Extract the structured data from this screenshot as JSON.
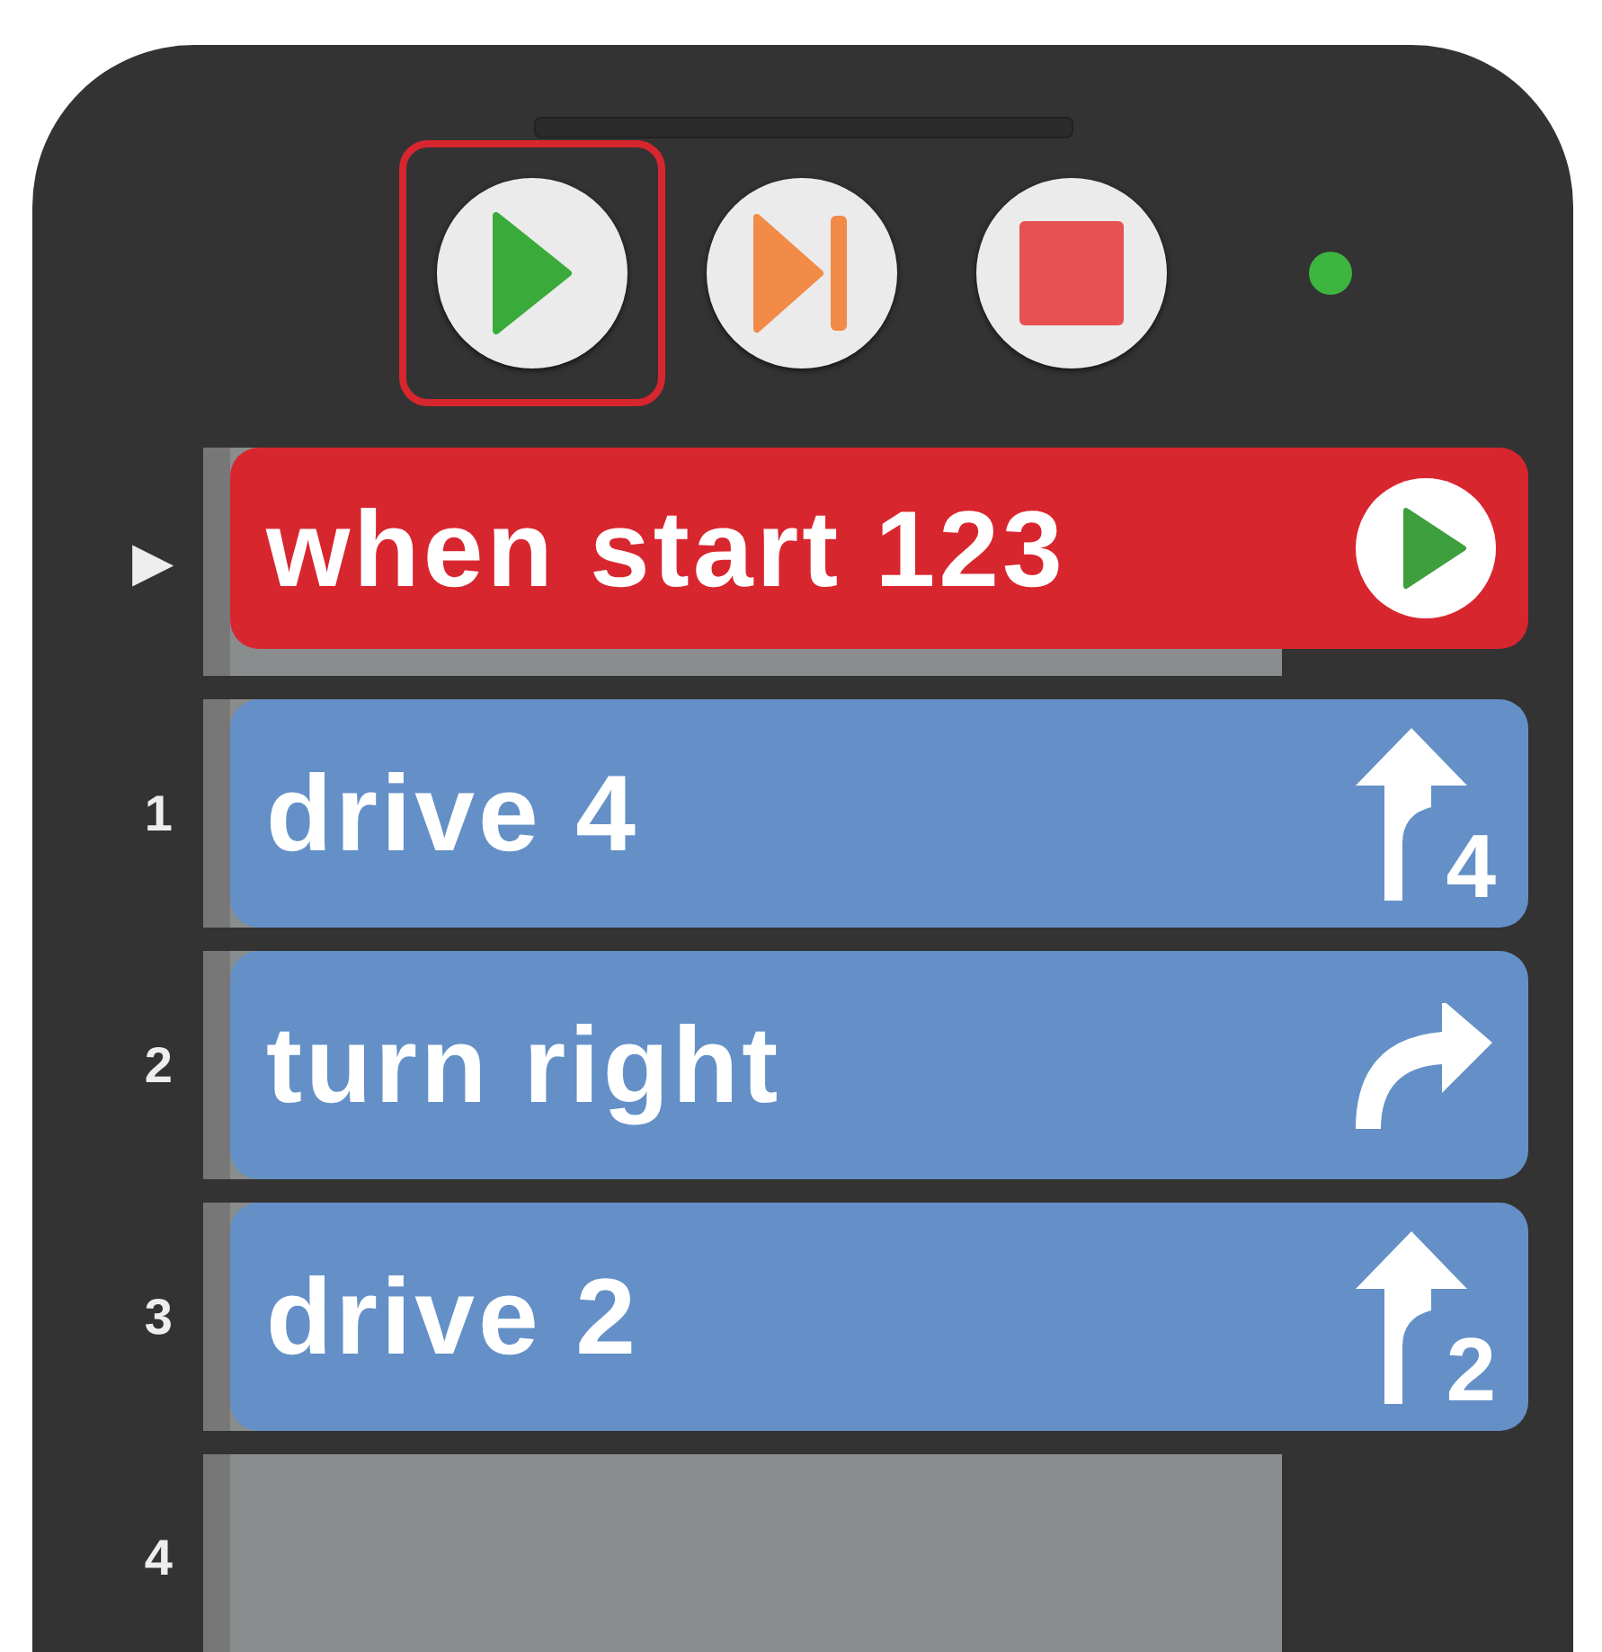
{
  "toolbar": {
    "buttons": [
      {
        "kind": "play",
        "selected": true
      },
      {
        "kind": "step",
        "selected": false
      },
      {
        "kind": "stop",
        "selected": false
      }
    ],
    "status": {
      "color": "#3db53f"
    }
  },
  "rows": [
    {
      "gutter": "▶",
      "block": {
        "kind": "event",
        "label": "when start 123"
      }
    },
    {
      "gutter": "1",
      "block": {
        "kind": "drive",
        "label": "drive 4",
        "icon_value": "4"
      }
    },
    {
      "gutter": "2",
      "block": {
        "kind": "turn",
        "label": "turn right"
      }
    },
    {
      "gutter": "3",
      "block": {
        "kind": "drive",
        "label": "drive 2",
        "icon_value": "2"
      }
    },
    {
      "gutter": "4"
    }
  ]
}
